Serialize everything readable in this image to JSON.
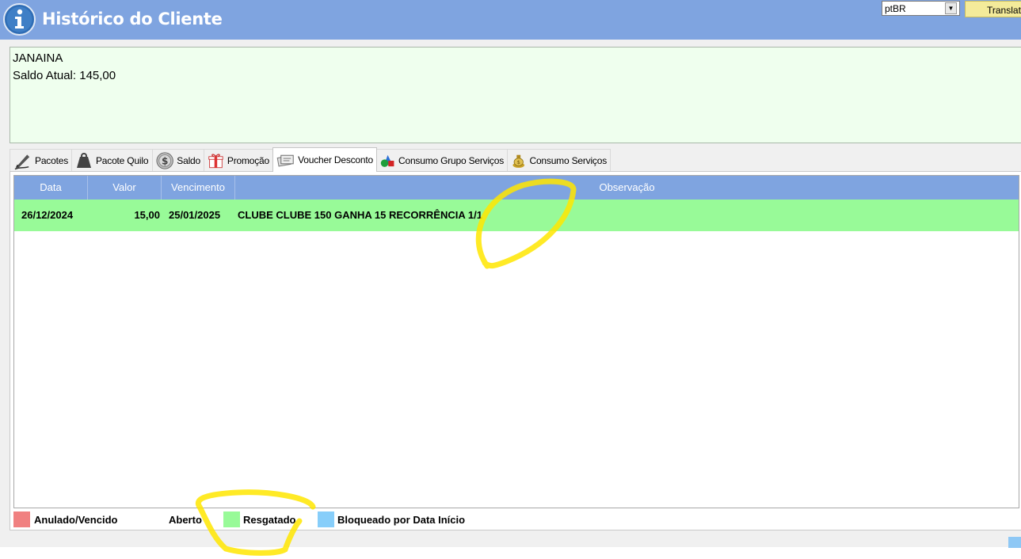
{
  "window": {
    "title": "Histórico do Cliente",
    "language": "ptBR",
    "translate_label": "Translate"
  },
  "customer": {
    "name": "JANAINA",
    "balance_text": "Saldo Atual: 145,00"
  },
  "tabs": [
    {
      "label": "Pacotes",
      "icon": "pen-icon"
    },
    {
      "label": "Pacote Quilo",
      "icon": "weight-icon"
    },
    {
      "label": "Saldo",
      "icon": "dollar-coin-icon"
    },
    {
      "label": "Promoção",
      "icon": "gift-icon"
    },
    {
      "label": "Voucher Desconto",
      "icon": "voucher-icon",
      "active": true
    },
    {
      "label": "Consumo Grupo Serviços",
      "icon": "shapes-icon"
    },
    {
      "label": "Consumo Serviços",
      "icon": "money-bag-icon"
    }
  ],
  "grid": {
    "columns": [
      "Data",
      "Valor",
      "Vencimento",
      "Observação"
    ],
    "rows": [
      {
        "data": "26/12/2024",
        "valor": "15,00",
        "vencimento": "25/01/2025",
        "observacao": "CLUBE CLUBE 150 GANHA 15 RECORRÊNCIA 1/1",
        "status_color": "#98fa98"
      }
    ]
  },
  "legend": [
    {
      "label": "Anulado/Vencido",
      "color": "#f08080"
    },
    {
      "label": "Aberto",
      "color": "#ffffff"
    },
    {
      "label": "Resgatado",
      "color": "#98fa98"
    },
    {
      "label": "Bloqueado por Data Início",
      "color": "#87cefa"
    }
  ],
  "colors": {
    "header": "#7fa4e0",
    "annotation": "#ffe600"
  }
}
